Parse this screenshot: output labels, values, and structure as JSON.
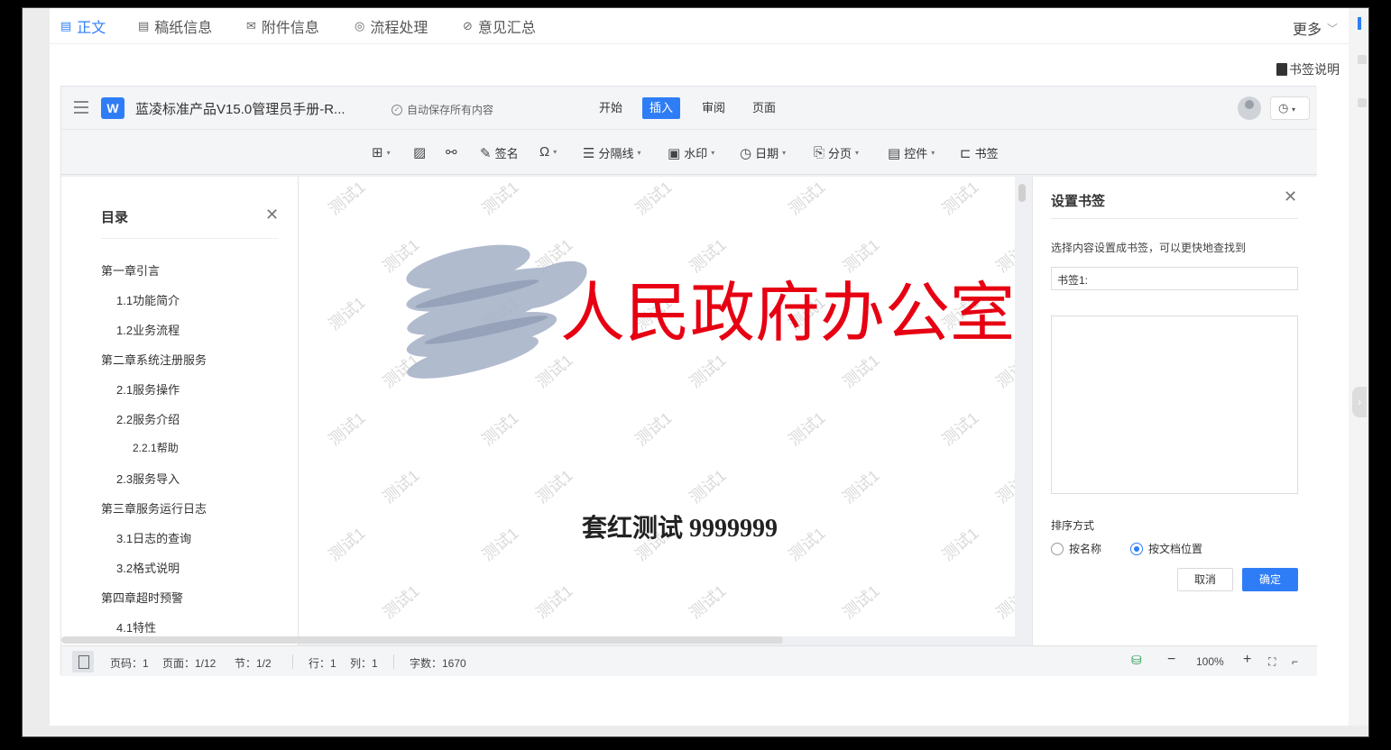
{
  "top_tabs": [
    {
      "label": "正文",
      "icon": "document-icon",
      "active": true
    },
    {
      "label": "稿纸信息",
      "icon": "paper-icon",
      "active": false
    },
    {
      "label": "附件信息",
      "icon": "mail-icon",
      "active": false
    },
    {
      "label": "流程处理",
      "icon": "flow-icon",
      "active": false
    },
    {
      "label": "意见汇总",
      "icon": "link-icon",
      "active": false
    }
  ],
  "more_label": "更多",
  "bookmark_help": "书签说明",
  "editor": {
    "logo": "W",
    "doc_title": "蓝凌标准产品V15.0管理员手册-R...",
    "autosave": "自动保存所有内容",
    "menu": [
      {
        "label": "开始",
        "active": false
      },
      {
        "label": "插入",
        "active": true
      },
      {
        "label": "审阅",
        "active": false
      },
      {
        "label": "页面",
        "active": false
      }
    ]
  },
  "toolbar": [
    {
      "icon": "table-icon",
      "glyph": "⊞",
      "label": "",
      "caret": true
    },
    {
      "icon": "image-icon",
      "glyph": "🖾",
      "label": "",
      "caret": false
    },
    {
      "icon": "link-icon",
      "glyph": "🔗",
      "label": "",
      "caret": false
    },
    {
      "icon": "signature-icon",
      "glyph": "✎",
      "label": "签名",
      "caret": false
    },
    {
      "icon": "symbol-icon",
      "glyph": "Ω",
      "label": "",
      "caret": true
    },
    {
      "icon": "divider-icon",
      "glyph": "☰",
      "label": "分隔线",
      "caret": true
    },
    {
      "icon": "watermark-icon",
      "glyph": "▣",
      "label": "水印",
      "caret": true
    },
    {
      "icon": "date-icon",
      "glyph": "◷",
      "label": "日期",
      "caret": true
    },
    {
      "icon": "page-break-icon",
      "glyph": "⎘",
      "label": "分页",
      "caret": true
    },
    {
      "icon": "control-icon",
      "glyph": "▤",
      "label": "控件",
      "caret": true
    },
    {
      "icon": "bookmark-icon",
      "glyph": "⊏",
      "label": "书签",
      "caret": false
    }
  ],
  "toc": {
    "title": "目录",
    "items": [
      {
        "label": "第一章引言",
        "level": 1
      },
      {
        "label": "1.1功能简介",
        "level": 2
      },
      {
        "label": "1.2业务流程",
        "level": 2
      },
      {
        "label": "第二章系统注册服务",
        "level": 1
      },
      {
        "label": "2.1服务操作",
        "level": 2
      },
      {
        "label": "2.2服务介绍",
        "level": 2
      },
      {
        "label": "2.2.1帮助",
        "level": 3
      },
      {
        "label": "2.3服务导入",
        "level": 2
      },
      {
        "label": "第三章服务运行日志",
        "level": 1
      },
      {
        "label": "3.1日志的查询",
        "level": 2
      },
      {
        "label": "3.2格式说明",
        "level": 2
      },
      {
        "label": "第四章超时预警",
        "level": 1
      },
      {
        "label": "4.1特性",
        "level": 2
      }
    ]
  },
  "document": {
    "red_title": "人民政府办公室文件",
    "sub_title": "套红测试 9999999",
    "watermark": "测试1"
  },
  "bookmark_panel": {
    "title": "设置书签",
    "desc": "选择内容设置成书签，可以更快地查找到",
    "input_value": "书签1:",
    "sort_label": "排序方式",
    "options": [
      {
        "label": "按名称",
        "checked": false
      },
      {
        "label": "按文档位置",
        "checked": true
      }
    ],
    "cancel": "取消",
    "confirm": "确定"
  },
  "status": {
    "page_code": "页码：1",
    "page": "页面：1/12",
    "section": "节：1/2",
    "row": "行：1",
    "col": "列：1",
    "words": "字数：1670",
    "zoom": "100%"
  },
  "colors": {
    "accent": "#2f7df6",
    "red_title": "#e60012"
  }
}
